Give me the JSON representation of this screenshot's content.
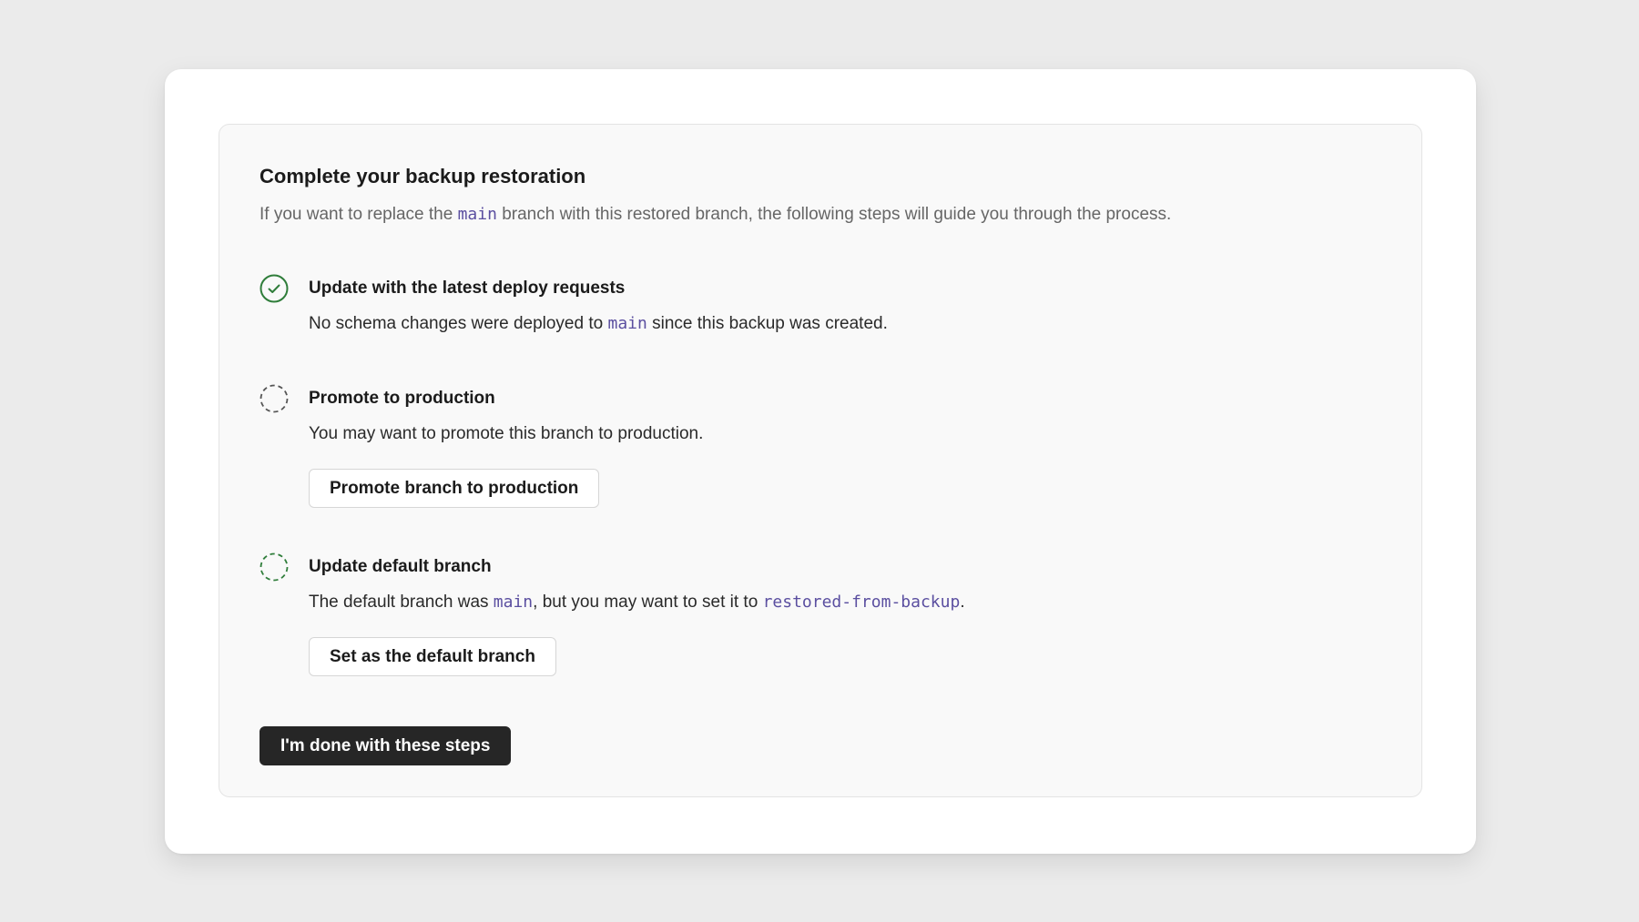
{
  "colors": {
    "page_background": "#ebebeb",
    "card_background": "#ffffff",
    "panel_background": "#f9f9f9",
    "success_green": "#2f7d3a",
    "pending_gray": "#555555",
    "code_purple": "#5b4fa0",
    "primary_button": "#262626"
  },
  "header": {
    "title": "Complete your backup restoration",
    "intro_before": "If you want to replace the ",
    "intro_code": "main",
    "intro_after": " branch with this restored branch, the following steps will guide you through the process."
  },
  "steps": [
    {
      "status": "complete",
      "icon": "check-circle-icon",
      "title": "Update with the latest deploy requests",
      "desc_before": "No schema changes were deployed to ",
      "desc_code": "main",
      "desc_after": " since this backup was created."
    },
    {
      "status": "pending",
      "icon": "dashed-circle-icon",
      "title": "Promote to production",
      "desc": "You may want to promote this branch to production.",
      "button_label": "Promote branch to production"
    },
    {
      "status": "pending",
      "icon": "dashed-circle-icon",
      "title": "Update default branch",
      "desc_before": "The default branch was ",
      "desc_code_1": "main",
      "desc_middle": ", but you may want to set it to ",
      "desc_code_2": "restored-from-backup",
      "desc_after": ".",
      "button_label": "Set as the default branch"
    }
  ],
  "footer": {
    "done_label": "I'm done with these steps"
  }
}
